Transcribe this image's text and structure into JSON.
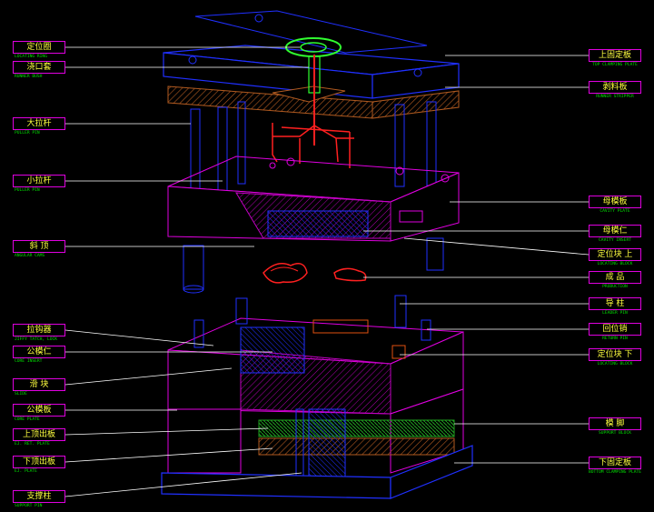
{
  "colors": {
    "background": "#000000",
    "plate_outline": "#e000e0",
    "blue_parts": "#2030ff",
    "hatch_brown": "#b05a20",
    "hatch_magenta": "#c000c0",
    "runner": "#ff2020",
    "label_text": "#ffff40",
    "sublabel_text": "#00e000",
    "leader_line": "#ffffff",
    "ring_green": "#30ff30"
  },
  "left_labels": [
    {
      "cn": "定位圈",
      "en": "LOCATING RING"
    },
    {
      "cn": "浇口套",
      "en": "RUNNER BUSH"
    },
    {
      "cn": "大拉杆",
      "en": "PULLER PIN"
    },
    {
      "cn": "小拉杆",
      "en": "PULLER PIN"
    },
    {
      "cn": "斜 顶",
      "en": "ANGULAR CAMS"
    },
    {
      "cn": "拉钩器",
      "en": "JIFFY TATCH, LOCK"
    },
    {
      "cn": "公模仁",
      "en": "CORE INSERT"
    },
    {
      "cn": "滑 块",
      "en": "SLIDE"
    },
    {
      "cn": "公模板",
      "en": "CORE PLATE"
    },
    {
      "cn": "上顶出板",
      "en": "EJ. RET. PLATE"
    },
    {
      "cn": "下顶出板",
      "en": "EJ. PLATE"
    },
    {
      "cn": "支撑柱",
      "en": "SUPPORT PIN"
    }
  ],
  "right_labels": [
    {
      "cn": "上固定板",
      "en": "TOP CLAMPING PLATE"
    },
    {
      "cn": "剥料板",
      "en": "RUNNER STRIPPER"
    },
    {
      "cn": "母模板",
      "en": "CAVITY PLATE"
    },
    {
      "cn": "母模仁",
      "en": "CAVITY INSERT"
    },
    {
      "cn": "定位块 上",
      "en": "LOCATING BLOCK"
    },
    {
      "cn": "成 品",
      "en": "PRODUCTION"
    },
    {
      "cn": "导 柱",
      "en": "LEADER PIN"
    },
    {
      "cn": "回位销",
      "en": "RETURN PIN"
    },
    {
      "cn": "定位块 下",
      "en": "LOCATING BLOCK"
    },
    {
      "cn": "模 脚",
      "en": "SUPPORT BLOCK"
    },
    {
      "cn": "下固定板",
      "en": "BOTTOM CLAMPING PLATE"
    }
  ]
}
